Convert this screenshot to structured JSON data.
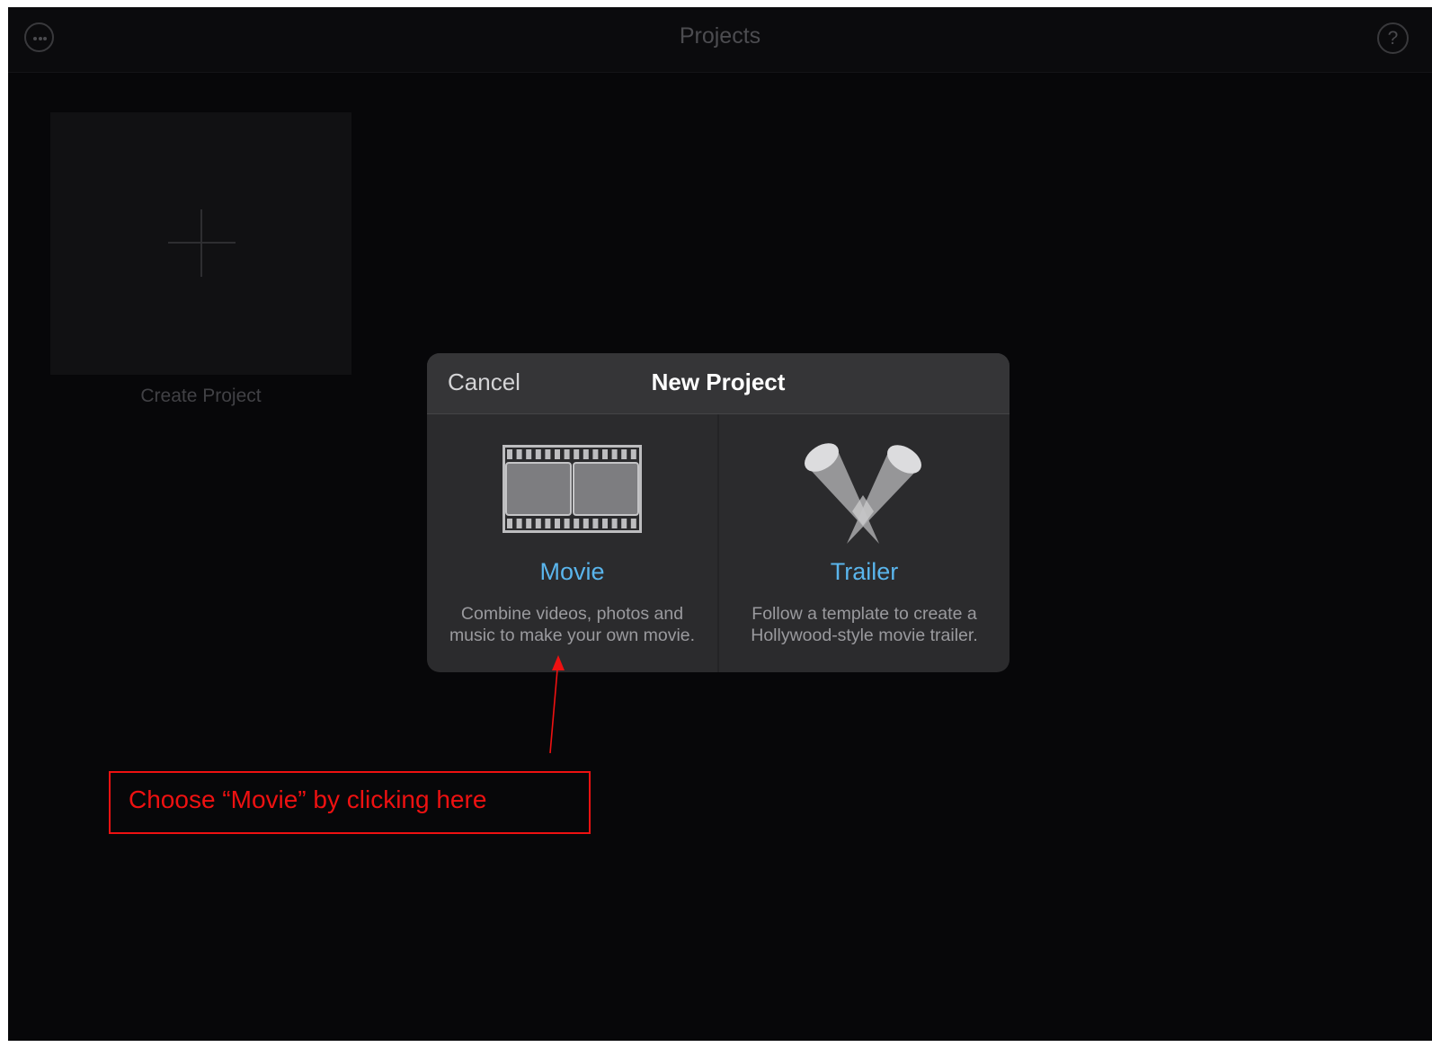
{
  "header": {
    "title": "Projects",
    "menu_icon": "ellipsis-circle-icon",
    "help_glyph": "?",
    "help_icon": "question-circle-icon"
  },
  "create_project": {
    "label": "Create Project",
    "icon": "plus-icon"
  },
  "dialog": {
    "title": "New Project",
    "cancel_label": "Cancel",
    "options": [
      {
        "label": "Movie",
        "icon": "film-strip-icon",
        "description_line1": "Combine videos, photos and",
        "description_line2": "music to make your own movie."
      },
      {
        "label": "Trailer",
        "icon": "spotlights-icon",
        "description_line1": "Follow a template to create a",
        "description_line2": "Hollywood-style movie trailer."
      }
    ]
  },
  "annotation": {
    "text": "Choose “Movie” by clicking here",
    "color": "#ee1111"
  },
  "colors": {
    "background": "#070709",
    "dialog": "#2b2b2d",
    "accent": "#5ab5ec"
  }
}
